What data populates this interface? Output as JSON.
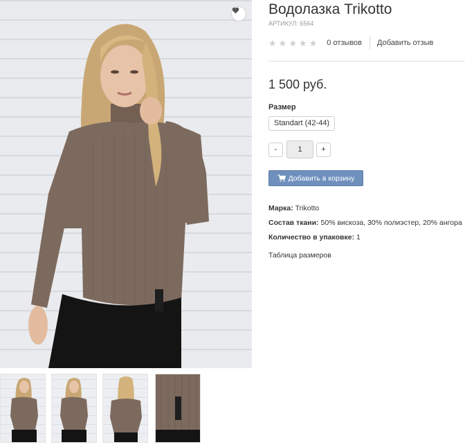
{
  "product": {
    "title": "Водолазка Trikotto",
    "sku": "АРТИКУЛ: 6564",
    "rating": {
      "stars": 0,
      "max": 5
    },
    "reviews_count": "0 отзывов",
    "add_review": "Добавить отзыв",
    "price": "1 500 руб.",
    "size_label": "Размер",
    "size_option": "Standart (42-44)",
    "qty": {
      "minus": "-",
      "value": "1",
      "plus": "+"
    },
    "add_to_cart": "Добавить в корзину",
    "properties": [
      {
        "key": "Марка:",
        "value": " Trikotto"
      },
      {
        "key": "Состав ткани:",
        "value": " 50% вискоза, 30% полиэстер, 20% ангора"
      },
      {
        "key": "Количество в упаковке:",
        "value": " 1"
      }
    ],
    "size_table_link": "Таблица размеров"
  },
  "icons": {
    "favorite": "heart-icon",
    "cart": "cart-icon",
    "star": "star-icon"
  },
  "colors": {
    "accent_button": "#6f90bd",
    "sweater": "#7d6a5e",
    "star_empty": "#cfcfcf"
  }
}
